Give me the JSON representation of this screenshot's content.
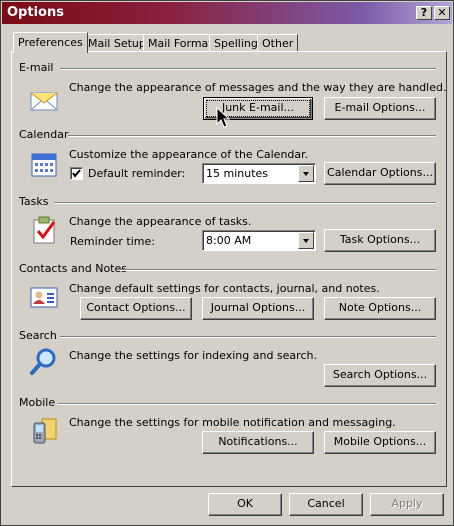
{
  "window": {
    "title": "Options",
    "help_button": "?",
    "close_button": "✕"
  },
  "tabs": [
    {
      "label": "Preferences",
      "active": true
    },
    {
      "label": "Mail Setup",
      "active": false
    },
    {
      "label": "Mail Format",
      "active": false
    },
    {
      "label": "Spelling",
      "active": false
    },
    {
      "label": "Other",
      "active": false
    }
  ],
  "sections": {
    "email": {
      "label": "E-mail",
      "description": "Change the appearance of messages and the way they are handled.",
      "junk_button": "Junk E-mail...",
      "options_button": "E-mail Options..."
    },
    "calendar": {
      "label": "Calendar",
      "description": "Customize the appearance of the Calendar.",
      "reminder_label": "Default reminder:",
      "reminder_checked": true,
      "reminder_value": "15 minutes",
      "options_button": "Calendar Options..."
    },
    "tasks": {
      "label": "Tasks",
      "description": "Change the appearance of tasks.",
      "reminder_label": "Reminder time:",
      "reminder_value": "8:00 AM",
      "options_button": "Task Options..."
    },
    "contacts": {
      "label": "Contacts and Notes",
      "description": "Change default settings for contacts, journal, and notes.",
      "contact_button": "Contact Options...",
      "journal_button": "Journal Options...",
      "note_button": "Note Options..."
    },
    "search": {
      "label": "Search",
      "description": "Change the settings for indexing and search.",
      "options_button": "Search Options..."
    },
    "mobile": {
      "label": "Mobile",
      "description": "Change the settings for mobile notification and messaging.",
      "notifications_button": "Notifications...",
      "options_button": "Mobile Options..."
    }
  },
  "footer": {
    "ok": "OK",
    "cancel": "Cancel",
    "apply": "Apply"
  },
  "icons": [
    "email-envelope-icon",
    "calendar-icon",
    "task-clipboard-icon",
    "contact-card-icon",
    "magnifier-icon",
    "mobile-phone-icon"
  ]
}
